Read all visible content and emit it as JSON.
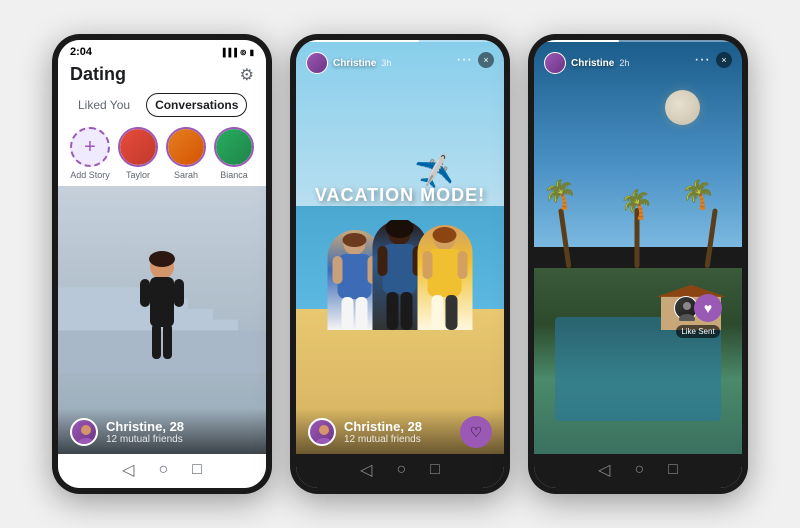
{
  "phone1": {
    "statusBar": {
      "time": "2:04",
      "icons": "●●●"
    },
    "header": {
      "title": "Dating",
      "gearIcon": "⚙"
    },
    "tabs": {
      "likedYou": "Liked You",
      "conversations": "Conversations"
    },
    "stories": [
      {
        "name": "Add Story",
        "type": "add"
      },
      {
        "name": "Taylor",
        "type": "user"
      },
      {
        "name": "Sarah",
        "type": "user"
      },
      {
        "name": "Bianca",
        "type": "user"
      }
    ],
    "card": {
      "name": "Christine, 28",
      "mutual": "12 mutual friends"
    },
    "navIcons": [
      "◁",
      "○",
      "□"
    ]
  },
  "phone2": {
    "statusBar": {
      "user": "Christine",
      "time": "3h"
    },
    "storyText": "VACATION MODE!",
    "planeEmoji": "✈️",
    "card": {
      "name": "Christine, 28",
      "mutual": "12 mutual friends"
    },
    "likeIcon": "♡",
    "moreIcon": "···",
    "closeIcon": "×",
    "navIcons": [
      "◁",
      "○",
      "□"
    ]
  },
  "phone3": {
    "statusBar": {
      "user": "Christine",
      "time": "2h"
    },
    "likeSent": "Like Sent",
    "heartIcon": "♥",
    "moreIcon": "···",
    "closeIcon": "×",
    "navIcons": [
      "◁",
      "○",
      "□"
    ]
  }
}
